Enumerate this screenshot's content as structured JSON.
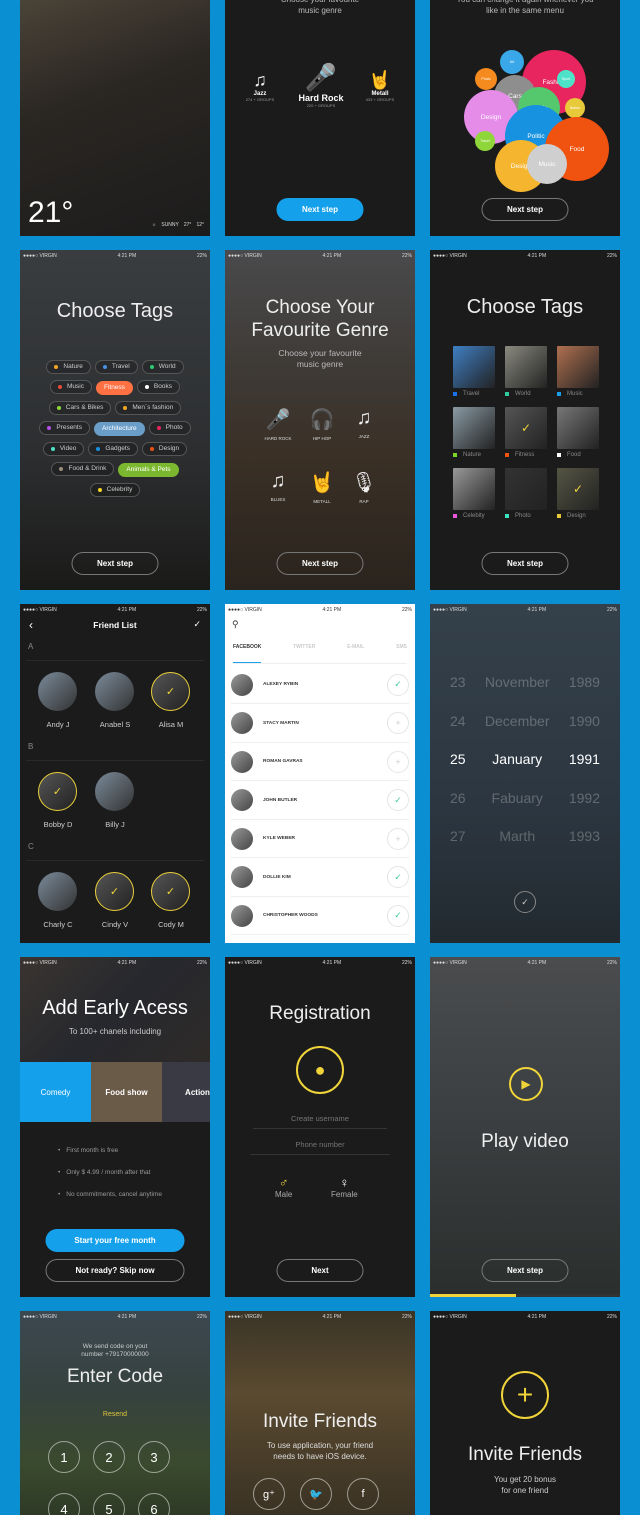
{
  "status": {
    "carrier": "●●●●○ VIRGIN",
    "time": "4:21 PM",
    "battery": "22%"
  },
  "weather": {
    "temp": "21°",
    "condition": "SUNNY",
    "high": "27°",
    "low": "12°"
  },
  "genre_top": {
    "subtitle": "Choose your favourite music genre",
    "items": [
      {
        "name": "Jazz",
        "groups": "274 + GROUPS"
      },
      {
        "name": "Hard Rock",
        "groups": "220 + GROUPS"
      },
      {
        "name": "Metall",
        "groups": "433 + GROUPS"
      }
    ],
    "button": "Next step"
  },
  "bubbles": {
    "subtitle": "You can change it again whenever you like in the same menu",
    "items": [
      {
        "label": "Art",
        "color": "#3aa8e8"
      },
      {
        "label": "Fashion",
        "color": "#e8255f"
      },
      {
        "label": "Photo",
        "color": "#f58a1f"
      },
      {
        "label": "Sport",
        "color": "#4ee3c8"
      },
      {
        "label": "Cars",
        "color": "#8e8e8e"
      },
      {
        "label": "Music",
        "color": "#55c86e"
      },
      {
        "label": "Design",
        "color": "#e58be8"
      },
      {
        "label": "Nature",
        "color": "#e8c93a"
      },
      {
        "label": "Politic",
        "color": "#1792e0"
      },
      {
        "label": "Food",
        "color": "#f0520f"
      },
      {
        "label": "Travel",
        "color": "#8ed63a"
      },
      {
        "label": "Design",
        "color": "#f5b52e"
      },
      {
        "label": "Music",
        "color": "#cfcfcf"
      }
    ],
    "button": "Next step"
  },
  "tags": {
    "title": "Choose Tags",
    "items": [
      {
        "label": "Nature",
        "color": "#f5a623"
      },
      {
        "label": "Travel",
        "color": "#4a90e2"
      },
      {
        "label": "World",
        "color": "#2ecc71"
      },
      {
        "label": "Music",
        "color": "#e74c3c"
      },
      {
        "label": "Fitness",
        "color": "#ff7043",
        "selected": "orange"
      },
      {
        "label": "Books",
        "color": "#ffffff"
      },
      {
        "label": "Cars & Bikes",
        "color": "#8ed63a"
      },
      {
        "label": "Men`s fashion",
        "color": "#f5a623"
      },
      {
        "label": "Presents",
        "color": "#b44fe8"
      },
      {
        "label": "Architecture",
        "color": "#6a9ec9",
        "selected": "blue"
      },
      {
        "label": "Photo",
        "color": "#e8255f"
      },
      {
        "label": "Video",
        "color": "#4ee3c8"
      },
      {
        "label": "Gadgets",
        "color": "#1792e0"
      },
      {
        "label": "Design",
        "color": "#f0520f"
      },
      {
        "label": "Food & Drink",
        "color": "#9e8e7e"
      },
      {
        "label": "Animals & Pets",
        "color": "#7cb82f",
        "selected": "green"
      },
      {
        "label": "Celebrity",
        "color": "#f5d623"
      }
    ],
    "button": "Next step"
  },
  "genre": {
    "title_line1": "Choose Your",
    "title_line2": "Favourite Genre",
    "subtitle": "Choose your favourite music genre",
    "items": [
      "HARD ROCK",
      "HIP HOP",
      "JAZZ",
      "BLUES",
      "METALL",
      "RAP"
    ],
    "selected": "HIP HOP",
    "accent": "#1aa3ec",
    "button": "Next step"
  },
  "photo_tags": {
    "title": "Choose Tags",
    "items": [
      {
        "label": "Travel",
        "color": "#1a73e8",
        "img": "#3f7fc4"
      },
      {
        "label": "World",
        "color": "#2ecc9a",
        "img": "#8a8a80"
      },
      {
        "label": "Music",
        "color": "#1a9ee8",
        "img": "#b07050"
      },
      {
        "label": "Nature",
        "color": "#7cd62a",
        "img": "#8a9aa4"
      },
      {
        "label": "Fitness",
        "color": "#f0520f",
        "img": "#555",
        "checked": true
      },
      {
        "label": "Food",
        "color": "#ffffff",
        "img": "#777"
      },
      {
        "label": "Celebity",
        "color": "#e858d8",
        "img": "#999"
      },
      {
        "label": "Photo",
        "color": "#3ae3c0",
        "img": "#333"
      },
      {
        "label": "Design",
        "color": "#e8c93a",
        "img": "#554",
        "checked": true
      }
    ],
    "button": "Next step"
  },
  "friends": {
    "title": "Friend List",
    "sections": [
      {
        "letter": "A",
        "people": [
          {
            "name": "Andy J"
          },
          {
            "name": "Anabel S"
          },
          {
            "name": "Alisa M",
            "selected": true
          }
        ]
      },
      {
        "letter": "B",
        "people": [
          {
            "name": "Bobby D",
            "selected": true
          },
          {
            "name": "Billy J"
          }
        ]
      },
      {
        "letter": "C",
        "people": [
          {
            "name": "Charly C"
          },
          {
            "name": "Cindy V",
            "selected": true
          },
          {
            "name": "Cody M",
            "selected": true
          }
        ]
      }
    ]
  },
  "social": {
    "tabs": [
      "FACEBOOK",
      "TWITTER",
      "E-MAIL",
      "SMS"
    ],
    "active_tab": "FACEBOOK",
    "contacts": [
      {
        "name": "ALEXEY RYBIN",
        "added": true
      },
      {
        "name": "STACY MARTIN",
        "added": false
      },
      {
        "name": "ROMAN GAVRAS",
        "added": false
      },
      {
        "name": "JOHN BUTLER",
        "added": true
      },
      {
        "name": "KYLE WEBER",
        "added": false
      },
      {
        "name": "DOLLIE KIM",
        "added": true
      },
      {
        "name": "CHRISTOPHER WOODS",
        "added": true
      }
    ],
    "check_color": "#3ec9a0"
  },
  "date_picker": {
    "rows": [
      [
        "23",
        "November",
        "1989"
      ],
      [
        "24",
        "December",
        "1990"
      ],
      [
        "25",
        "January",
        "1991"
      ],
      [
        "26",
        "Fabuary",
        "1992"
      ],
      [
        "27",
        "Marth",
        "1993"
      ]
    ],
    "selected_index": 2
  },
  "early": {
    "title": "Add Early Acess",
    "subtitle": "To 100+ chanels including",
    "categories": [
      "Comedy",
      "Food show",
      "Action"
    ],
    "active": "Comedy",
    "bullets": [
      "First month is free",
      "Only $ 4.99 / month after that",
      "No commitments, cancel anytime"
    ],
    "primary": "Start your free month",
    "secondary": "Not ready? Skip now"
  },
  "registration": {
    "title": "Registration",
    "username_placeholder": "Create username",
    "phone_placeholder": "Phone number",
    "male": "Male",
    "female": "Female",
    "button": "Next",
    "accent": "#f0d43a"
  },
  "video": {
    "title": "Play video",
    "button": "Next step",
    "progress": 0.45
  },
  "code": {
    "info_line1": "We send code on yout",
    "info_line2": "number +79170000000",
    "title": "Enter Code",
    "resend": "Resend",
    "keys": [
      "1",
      "2",
      "3",
      "4",
      "5",
      "6"
    ]
  },
  "invite": {
    "title": "Invite Friends",
    "line1": "To use application, your friend",
    "line2": "needs to have iOS device.",
    "social": [
      "g+",
      "twitter",
      "f"
    ]
  },
  "invite2": {
    "title": "Invite Friends",
    "line1": "You get 20 bonus",
    "line2": "for one friend"
  }
}
